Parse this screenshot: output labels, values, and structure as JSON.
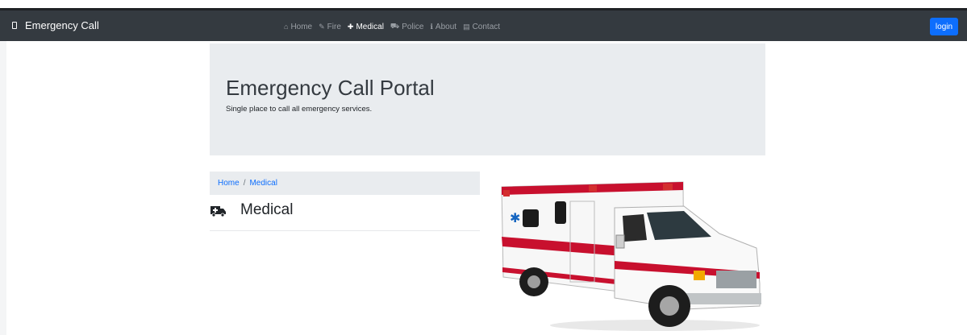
{
  "brand": {
    "title": "Emergency Call",
    "icon": "phone-icon"
  },
  "nav": {
    "items": [
      {
        "label": "Home",
        "icon": "home-icon",
        "glyph": "⌂"
      },
      {
        "label": "Fire",
        "icon": "fire-icon",
        "glyph": "✎"
      },
      {
        "label": "Medical",
        "icon": "ambulance-icon",
        "glyph": "✚"
      },
      {
        "label": "Police",
        "icon": "car-icon",
        "glyph": "⛟"
      },
      {
        "label": "About",
        "icon": "info-icon",
        "glyph": "ℹ"
      },
      {
        "label": "Contact",
        "icon": "contact-card-icon",
        "glyph": "▤"
      }
    ],
    "active": "Medical",
    "login_label": "login"
  },
  "jumbotron": {
    "title": "Emergency Call Portal",
    "subtitle": "Single place to call all emergency services."
  },
  "breadcrumb": {
    "home": "Home",
    "separator": "/",
    "current": "Medical"
  },
  "section": {
    "title": "Medical",
    "icon": "ambulance-icon"
  },
  "image": {
    "subject": "ambulance-image"
  },
  "colors": {
    "navbar": "#343a40",
    "accent": "#0d6efd",
    "jumbotron": "#e9ecef",
    "ambulance_red": "#c8102e"
  }
}
